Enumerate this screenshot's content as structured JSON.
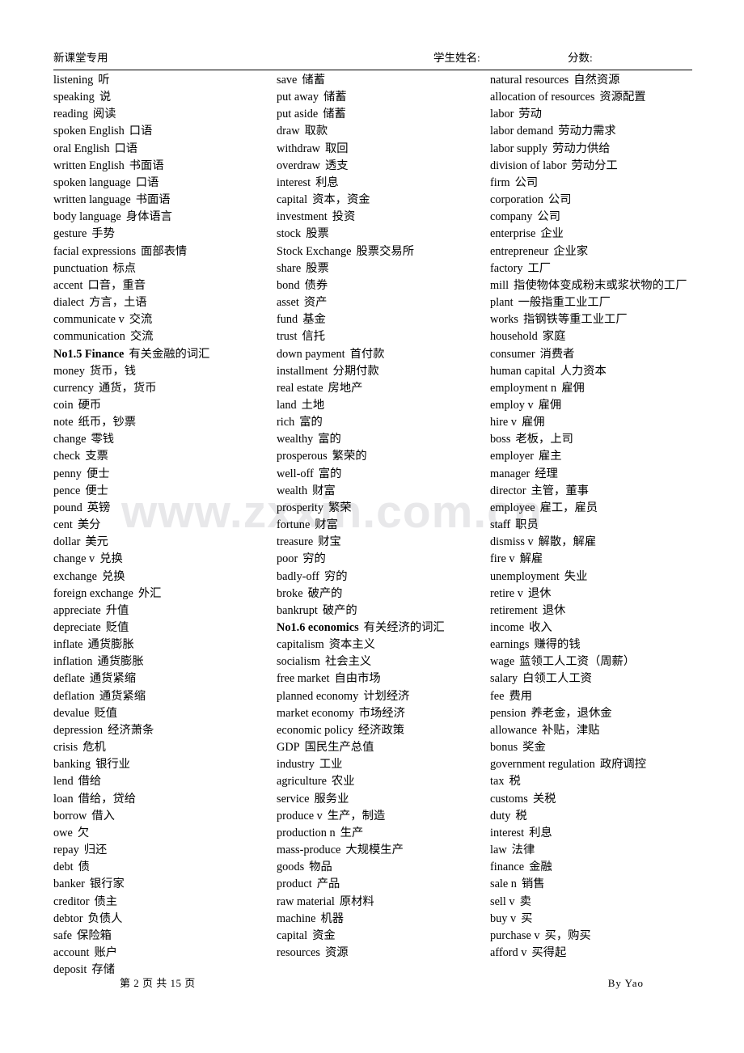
{
  "header": {
    "left_label": "新课堂专用",
    "student_name_label": "学生姓名:",
    "score_label": "分数:"
  },
  "watermark": {
    "text": "www.zxxin.com.cn",
    "color": "#e8e8ea"
  },
  "footer": {
    "page_info": "第 2 页 共 15 页",
    "author": "By Yao"
  },
  "columns": [
    {
      "id": "column-1",
      "entries": [
        {
          "en": "listening",
          "cn": "听"
        },
        {
          "en": "speaking",
          "cn": "说"
        },
        {
          "en": "reading",
          "cn": "阅读"
        },
        {
          "en": "spoken English",
          "cn": "口语"
        },
        {
          "en": "oral English",
          "cn": "口语"
        },
        {
          "en": "written English",
          "cn": "书面语"
        },
        {
          "en": "spoken language",
          "cn": "口语"
        },
        {
          "en": "written language",
          "cn": "书面语"
        },
        {
          "en": "body language",
          "cn": "身体语言"
        },
        {
          "en": "gesture",
          "cn": "手势"
        },
        {
          "en": "facial expressions",
          "cn": "面部表情"
        },
        {
          "en": "punctuation",
          "cn": "标点"
        },
        {
          "en": "accent",
          "cn": "口音，重音"
        },
        {
          "en": "dialect",
          "cn": "方言，土语"
        },
        {
          "en": "communicate v",
          "cn": "交流"
        },
        {
          "en": "communication",
          "cn": "交流"
        },
        {
          "en": "No1.5 Finance",
          "cn": "有关金融的词汇",
          "heading": true
        },
        {
          "en": "money",
          "cn": "货币，钱"
        },
        {
          "en": "currency",
          "cn": "通货，货币"
        },
        {
          "en": "coin",
          "cn": "硬币"
        },
        {
          "en": "note",
          "cn": "纸币，钞票"
        },
        {
          "en": "change",
          "cn": "零钱"
        },
        {
          "en": "check",
          "cn": "支票"
        },
        {
          "en": "penny",
          "cn": "便士"
        },
        {
          "en": "pence",
          "cn": "便士"
        },
        {
          "en": "pound",
          "cn": "英镑"
        },
        {
          "en": "cent",
          "cn": "美分"
        },
        {
          "en": "dollar",
          "cn": "美元"
        },
        {
          "en": "change v",
          "cn": "兑换"
        },
        {
          "en": "exchange",
          "cn": "兑换"
        },
        {
          "en": "foreign exchange",
          "cn": "外汇"
        },
        {
          "en": "appreciate",
          "cn": "升值"
        },
        {
          "en": "depreciate",
          "cn": "贬值"
        },
        {
          "en": "inflate",
          "cn": "通货膨胀"
        },
        {
          "en": "inflation",
          "cn": "通货膨胀"
        },
        {
          "en": "deflate",
          "cn": "通货紧缩"
        },
        {
          "en": "deflation",
          "cn": "通货紧缩"
        },
        {
          "en": "devalue",
          "cn": "贬值"
        },
        {
          "en": "depression",
          "cn": "经济萧条"
        },
        {
          "en": "crisis",
          "cn": "危机"
        },
        {
          "en": "banking",
          "cn": "银行业"
        },
        {
          "en": "lend",
          "cn": "借给"
        },
        {
          "en": "loan",
          "cn": "借给，贷给"
        },
        {
          "en": "borrow",
          "cn": "借入"
        },
        {
          "en": "owe",
          "cn": "欠"
        },
        {
          "en": "repay",
          "cn": "归还"
        },
        {
          "en": "debt",
          "cn": "债"
        },
        {
          "en": "banker",
          "cn": "银行家"
        },
        {
          "en": "creditor",
          "cn": "债主"
        },
        {
          "en": "debtor",
          "cn": "负债人"
        },
        {
          "en": "safe",
          "cn": "保险箱"
        },
        {
          "en": "account",
          "cn": "账户"
        },
        {
          "en": "deposit",
          "cn": "存储"
        }
      ]
    },
    {
      "id": "column-2",
      "entries": [
        {
          "en": "save",
          "cn": "储蓄"
        },
        {
          "en": "put away",
          "cn": "储蓄"
        },
        {
          "en": "put aside",
          "cn": "储蓄"
        },
        {
          "en": "draw",
          "cn": "取款"
        },
        {
          "en": "withdraw",
          "cn": "取回"
        },
        {
          "en": "overdraw",
          "cn": "透支"
        },
        {
          "en": "interest",
          "cn": "利息"
        },
        {
          "en": "capital",
          "cn": "资本，资金"
        },
        {
          "en": "investment",
          "cn": "投资"
        },
        {
          "en": "stock",
          "cn": "股票"
        },
        {
          "en": "Stock Exchange",
          "cn": "股票交易所"
        },
        {
          "en": "share",
          "cn": "股票"
        },
        {
          "en": "bond",
          "cn": "债券"
        },
        {
          "en": "asset",
          "cn": "资产"
        },
        {
          "en": "fund",
          "cn": "基金"
        },
        {
          "en": "trust",
          "cn": "信托"
        },
        {
          "en": "down payment",
          "cn": "首付款"
        },
        {
          "en": "installment",
          "cn": "分期付款"
        },
        {
          "en": "real estate",
          "cn": "房地产"
        },
        {
          "en": "land",
          "cn": "土地"
        },
        {
          "en": "rich",
          "cn": "富的"
        },
        {
          "en": "wealthy",
          "cn": "富的"
        },
        {
          "en": "prosperous",
          "cn": "繁荣的"
        },
        {
          "en": "well-off",
          "cn": "富的"
        },
        {
          "en": "wealth",
          "cn": "财富"
        },
        {
          "en": "prosperity",
          "cn": "繁荣"
        },
        {
          "en": "fortune",
          "cn": "财富"
        },
        {
          "en": "treasure",
          "cn": "财宝"
        },
        {
          "en": "poor",
          "cn": "穷的"
        },
        {
          "en": "badly-off",
          "cn": "穷的"
        },
        {
          "en": "broke",
          "cn": "破产的"
        },
        {
          "en": "bankrupt",
          "cn": "破产的"
        },
        {
          "en": "No1.6 economics",
          "cn": "有关经济的词汇",
          "heading": true
        },
        {
          "en": "capitalism",
          "cn": "资本主义"
        },
        {
          "en": "socialism",
          "cn": "社会主义"
        },
        {
          "en": "free market",
          "cn": "自由市场"
        },
        {
          "en": "planned economy",
          "cn": "计划经济"
        },
        {
          "en": "market economy",
          "cn": "市场经济"
        },
        {
          "en": "economic policy",
          "cn": "经济政策"
        },
        {
          "en": "GDP",
          "cn": "国民生产总值"
        },
        {
          "en": "industry",
          "cn": "工业"
        },
        {
          "en": "agriculture",
          "cn": "农业"
        },
        {
          "en": "service",
          "cn": "服务业"
        },
        {
          "en": "produce v",
          "cn": "生产，制造"
        },
        {
          "en": "production n",
          "cn": "生产"
        },
        {
          "en": "mass-produce",
          "cn": "大规模生产"
        },
        {
          "en": "goods",
          "cn": "物品"
        },
        {
          "en": "product",
          "cn": "产品"
        },
        {
          "en": "raw material",
          "cn": "原材料"
        },
        {
          "en": "machine",
          "cn": "机器"
        },
        {
          "en": "capital",
          "cn": "资金"
        },
        {
          "en": "resources",
          "cn": "资源"
        }
      ]
    },
    {
      "id": "column-3",
      "entries": [
        {
          "en": "natural resources",
          "cn": "自然资源"
        },
        {
          "en": "allocation of resources",
          "cn": "资源配置"
        },
        {
          "en": "labor",
          "cn": "劳动"
        },
        {
          "en": "labor demand",
          "cn": "劳动力需求"
        },
        {
          "en": "labor supply",
          "cn": "劳动力供给"
        },
        {
          "en": "division of labor",
          "cn": "劳动分工"
        },
        {
          "en": "firm",
          "cn": "公司"
        },
        {
          "en": "corporation",
          "cn": "公司"
        },
        {
          "en": "company",
          "cn": "公司"
        },
        {
          "en": "enterprise",
          "cn": "企业"
        },
        {
          "en": "entrepreneur",
          "cn": "企业家"
        },
        {
          "en": "factory",
          "cn": "工厂"
        },
        {
          "en": "mill",
          "cn": "指使物体变成粉末或浆状物的工厂"
        },
        {
          "en": "plant",
          "cn": "一般指重工业工厂"
        },
        {
          "en": "works",
          "cn": "指钢铁等重工业工厂"
        },
        {
          "en": "household",
          "cn": "家庭"
        },
        {
          "en": "consumer",
          "cn": "消费者"
        },
        {
          "en": "human capital",
          "cn": "人力资本"
        },
        {
          "en": "employment n",
          "cn": "雇佣"
        },
        {
          "en": "employ v",
          "cn": "雇佣"
        },
        {
          "en": "hire v",
          "cn": "雇佣"
        },
        {
          "en": "boss",
          "cn": "老板，上司"
        },
        {
          "en": "employer",
          "cn": "雇主"
        },
        {
          "en": "manager",
          "cn": "经理"
        },
        {
          "en": "director",
          "cn": "主管，董事"
        },
        {
          "en": "employee",
          "cn": "雇工，雇员"
        },
        {
          "en": "staff",
          "cn": "职员"
        },
        {
          "en": "dismiss v",
          "cn": "解散，解雇"
        },
        {
          "en": "fire v",
          "cn": "解雇"
        },
        {
          "en": "unemployment",
          "cn": "失业"
        },
        {
          "en": "retire v",
          "cn": "退休"
        },
        {
          "en": "retirement",
          "cn": "退休"
        },
        {
          "en": "income",
          "cn": "收入"
        },
        {
          "en": "earnings",
          "cn": "赚得的钱"
        },
        {
          "en": "wage",
          "cn": "蓝领工人工资（周薪）"
        },
        {
          "en": "salary",
          "cn": "白领工人工资"
        },
        {
          "en": "fee",
          "cn": "费用"
        },
        {
          "en": "pension",
          "cn": "养老金，退休金"
        },
        {
          "en": "allowance",
          "cn": "补贴，津贴"
        },
        {
          "en": "bonus",
          "cn": "奖金"
        },
        {
          "en": "government regulation",
          "cn": "政府调控"
        },
        {
          "en": "tax",
          "cn": "税"
        },
        {
          "en": "customs",
          "cn": "关税"
        },
        {
          "en": "duty",
          "cn": "税"
        },
        {
          "en": "interest",
          "cn": "利息"
        },
        {
          "en": "law",
          "cn": "法律"
        },
        {
          "en": "finance",
          "cn": "金融"
        },
        {
          "en": "sale n",
          "cn": "销售"
        },
        {
          "en": "sell v",
          "cn": "卖"
        },
        {
          "en": "buy v",
          "cn": "买"
        },
        {
          "en": "purchase v",
          "cn": "买，购买"
        },
        {
          "en": "afford v",
          "cn": "买得起"
        }
      ]
    }
  ]
}
